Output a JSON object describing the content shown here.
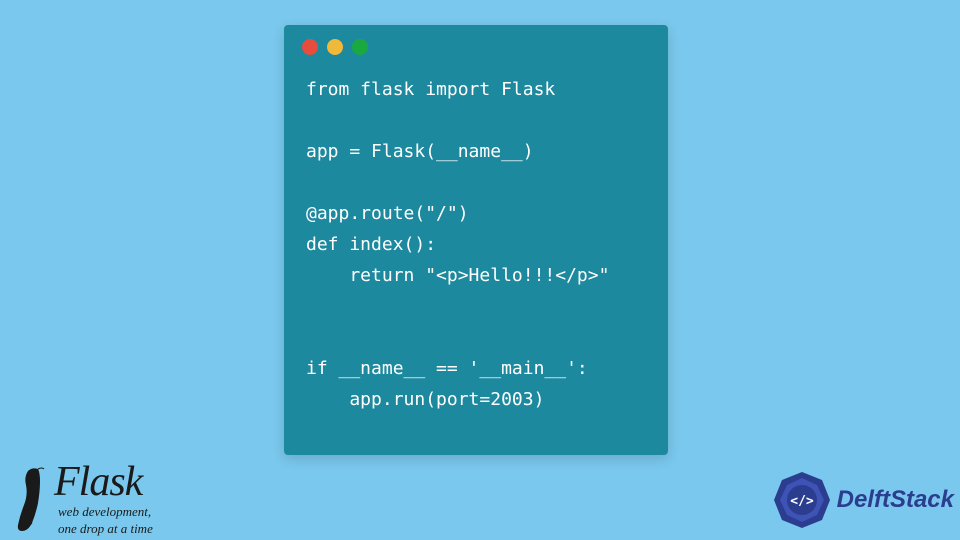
{
  "code": {
    "lines": "from flask import Flask\n\napp = Flask(__name__)\n\n@app.route(\"/\")\ndef index():\n    return \"<p>Hello!!!</p>\"\n\n\nif __name__ == '__main__':\n    app.run(port=2003)"
  },
  "flask_logo": {
    "title": "Flask",
    "subtitle1": "web development,",
    "subtitle2": "one drop at a time"
  },
  "delft_logo": {
    "text": "DelftStack",
    "badge_glyph": "</>"
  }
}
